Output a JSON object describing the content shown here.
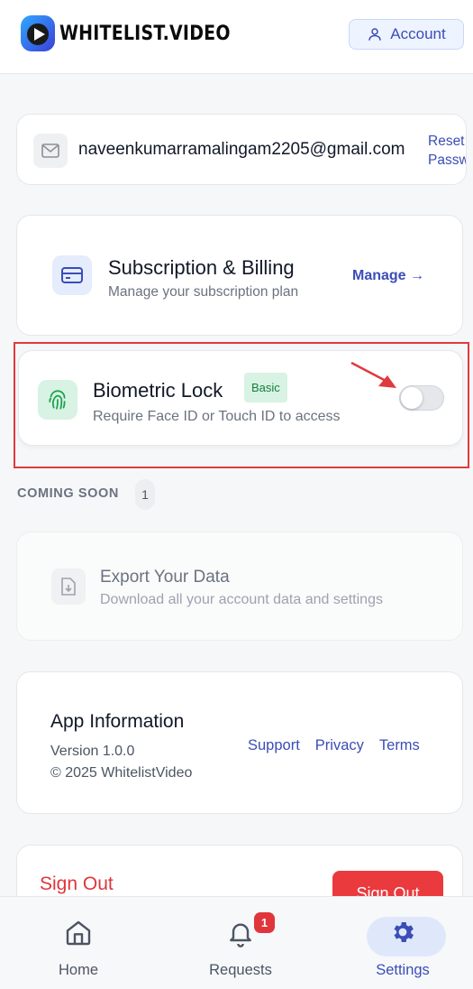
{
  "header": {
    "brand": "WHITELIST.VIDEO",
    "account_label": "Account"
  },
  "account": {
    "email": "naveenkumarramalingam2205@gmail.com",
    "reset_password_label": "Reset Password"
  },
  "subscription": {
    "title": "Subscription & Billing",
    "description": "Manage your subscription plan",
    "manage_label": "Manage →"
  },
  "biometric": {
    "title": "Biometric Lock",
    "badge": "Basic",
    "description": "Require Face ID or Touch ID to access",
    "enabled": false
  },
  "coming_soon": {
    "label": "COMING SOON",
    "count": "1",
    "items": [
      {
        "title": "Export Your Data",
        "description": "Download all your account data and settings"
      }
    ]
  },
  "app_info": {
    "title": "App Information",
    "version": "Version 1.0.0",
    "copyright": "© 2025 WhitelistVideo",
    "links": [
      "Support",
      "Privacy",
      "Terms"
    ]
  },
  "sign_out": {
    "title": "Sign Out",
    "button_label": "Sign Out"
  },
  "bottom_nav": {
    "items": [
      {
        "label": "Home",
        "icon": "home-icon"
      },
      {
        "label": "Requests",
        "icon": "bell-icon",
        "badge": "1"
      },
      {
        "label": "Settings",
        "icon": "gear-icon",
        "active": true
      }
    ]
  },
  "colors": {
    "accent": "#3b4db6",
    "danger": "#ea3a3e",
    "success": "#15803d"
  }
}
